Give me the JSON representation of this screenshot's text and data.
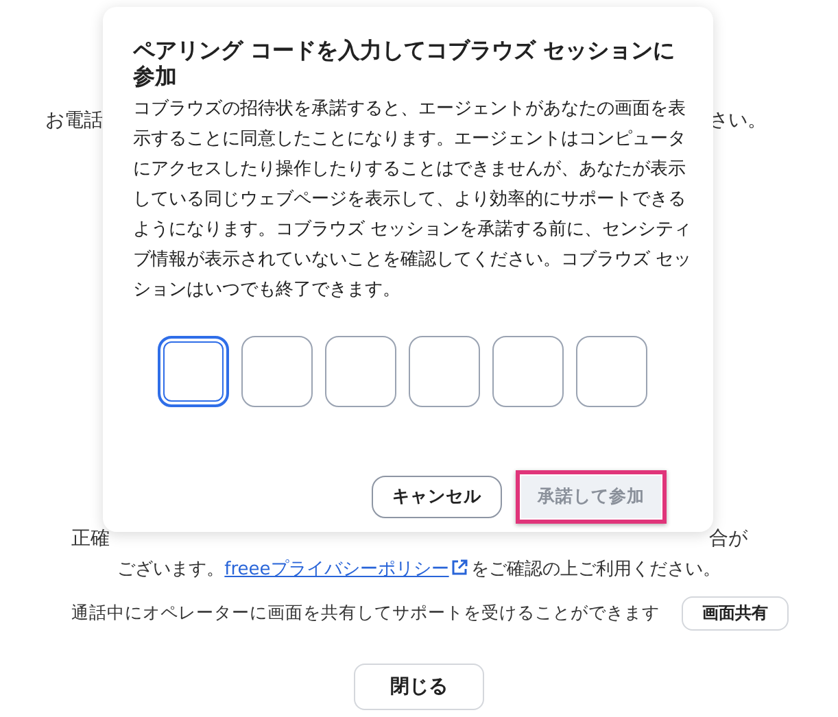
{
  "page": {
    "line_1_start": "お電話",
    "line_1_end": "さい。",
    "line_2_start": "正確",
    "line_2_end": "合が",
    "privacy": {
      "before": "ございます。",
      "link": "freeeプライバシーポリシー",
      "after": "をご確認の上ご利用ください。"
    },
    "share_text": "通話中にオペレーターに画面を共有してサポートを受けることができます",
    "share_button": "画面共有",
    "close_button": "閉じる"
  },
  "dialog": {
    "title": "ペアリング コードを入力してコブラウズ セッションに参加",
    "body": "コブラウズの招待状を承諾すると、エージェントがあなたの画面を表示することに同意したことになります。エージェントはコンピュータにアクセスしたり操作したりすることはできませんが、あなたが表示している同じウェブページを表示して、より効率的にサポートできるようになります。コブラウズ セッションを承諾する前に、センシティブ情報が表示されていないことを確認してください。コブラウズ セッションはいつでも終了できます。",
    "code_boxes": [
      {
        "focused": true
      },
      {
        "focused": false
      },
      {
        "focused": false
      },
      {
        "focused": false
      },
      {
        "focused": false
      },
      {
        "focused": false
      }
    ],
    "buttons": [
      {
        "label": "キャンセル",
        "kind": "secondary",
        "disabled": false,
        "highlighted": false
      },
      {
        "label": "承諾して参加",
        "kind": "primary",
        "disabled": true,
        "highlighted": true
      }
    ]
  }
}
